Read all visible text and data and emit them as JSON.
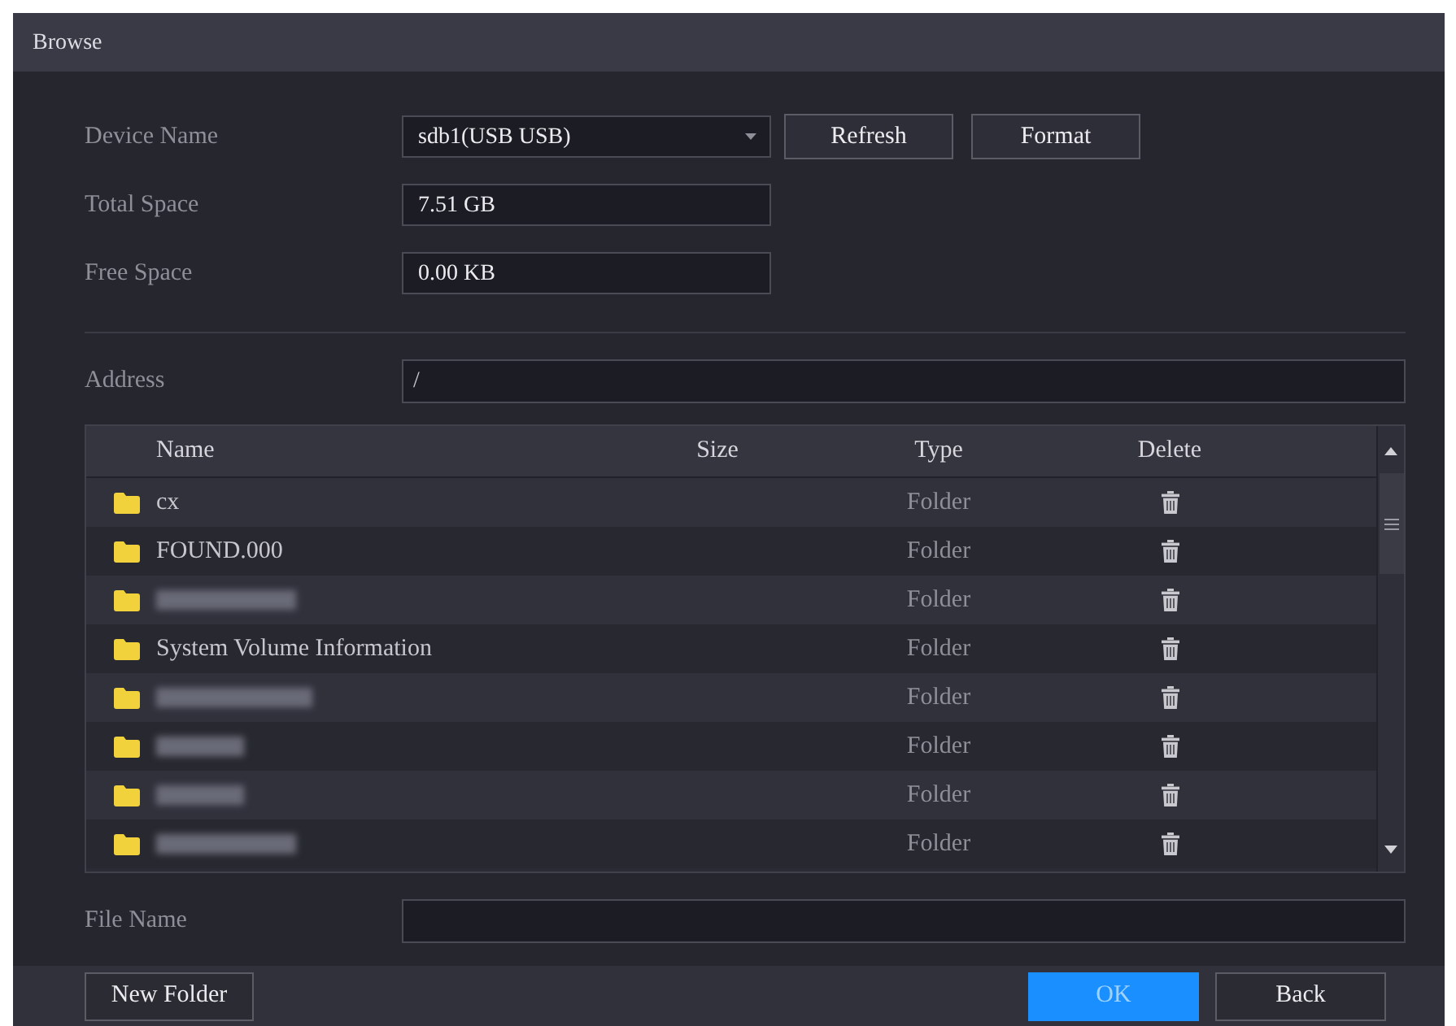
{
  "window": {
    "title": "Browse"
  },
  "fields": [
    {
      "label": "Device Name",
      "value": "sdb1(USB USB)",
      "kind": "select"
    },
    {
      "label": "Total Space",
      "value": "7.51 GB",
      "kind": "text"
    },
    {
      "label": "Free Space",
      "value": "0.00 KB",
      "kind": "text"
    }
  ],
  "device_buttons": [
    "Refresh",
    "Format"
  ],
  "address": {
    "label": "Address",
    "value": "/"
  },
  "table": {
    "columns": [
      "Name",
      "Size",
      "Type",
      "Delete"
    ],
    "rows": [
      {
        "name": "cx",
        "blurred": false,
        "type": "Folder"
      },
      {
        "name": "FOUND.000",
        "blurred": false,
        "type": "Folder"
      },
      {
        "blurred": true,
        "type": "Folder"
      },
      {
        "name": "System Volume Information",
        "blurred": false,
        "type": "Folder"
      },
      {
        "blurred": true,
        "type": "Folder"
      },
      {
        "blurred": true,
        "type": "Folder"
      },
      {
        "blurred": true,
        "type": "Folder"
      },
      {
        "blurred": true,
        "type": "Folder"
      }
    ]
  },
  "file_name": {
    "label": "File Name"
  },
  "footer": {
    "left_button": "New Folder",
    "buttons": [
      {
        "label": "OK",
        "kind": "primary"
      },
      {
        "label": "Back",
        "kind": "default"
      }
    ]
  }
}
